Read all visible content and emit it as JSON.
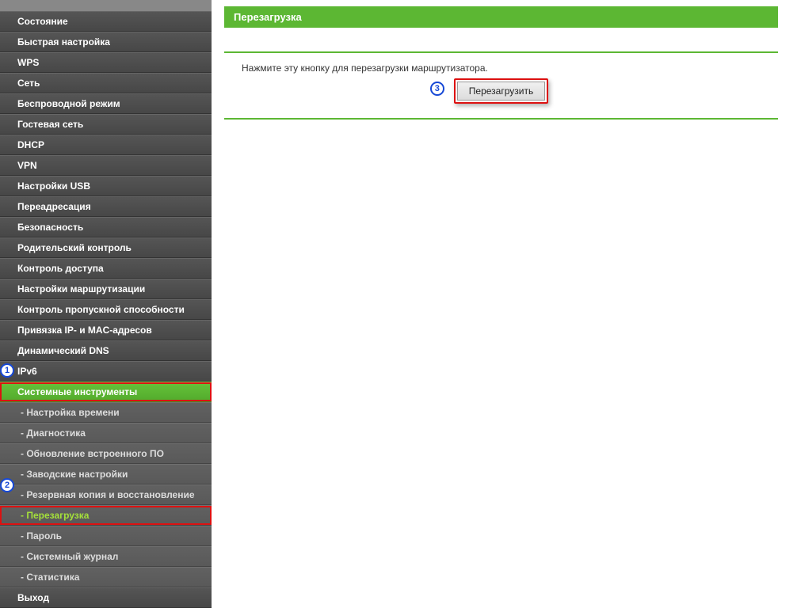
{
  "sidebar": {
    "items": [
      {
        "label": "Состояние"
      },
      {
        "label": "Быстрая настройка"
      },
      {
        "label": "WPS"
      },
      {
        "label": "Сеть"
      },
      {
        "label": "Беспроводной режим"
      },
      {
        "label": "Гостевая сеть"
      },
      {
        "label": "DHCP"
      },
      {
        "label": "VPN"
      },
      {
        "label": "Настройки USB"
      },
      {
        "label": "Переадресация"
      },
      {
        "label": "Безопасность"
      },
      {
        "label": "Родительский контроль"
      },
      {
        "label": "Контроль доступа"
      },
      {
        "label": "Настройки маршрутизации"
      },
      {
        "label": "Контроль пропускной способности"
      },
      {
        "label": "Привязка IP- и MAC-адресов"
      },
      {
        "label": "Динамический DNS"
      },
      {
        "label": "IPv6"
      }
    ],
    "active_section": "Системные инструменты",
    "subitems": [
      {
        "label": "- Настройка времени"
      },
      {
        "label": "- Диагностика"
      },
      {
        "label": "- Обновление встроенного ПО"
      },
      {
        "label": "- Заводские настройки"
      },
      {
        "label": "- Резервная копия и восстановление"
      },
      {
        "label": "- Перезагрузка",
        "selected": true
      },
      {
        "label": "- Пароль"
      },
      {
        "label": "- Системный журнал"
      },
      {
        "label": "- Статистика"
      }
    ],
    "after": [
      {
        "label": "Выход"
      }
    ]
  },
  "page": {
    "title": "Перезагрузка",
    "instruction": "Нажмите эту кнопку для перезагрузки маршрутизатора.",
    "reboot_button": "Перезагрузить"
  },
  "callouts": {
    "c1": "1",
    "c2": "2",
    "c3": "3"
  }
}
